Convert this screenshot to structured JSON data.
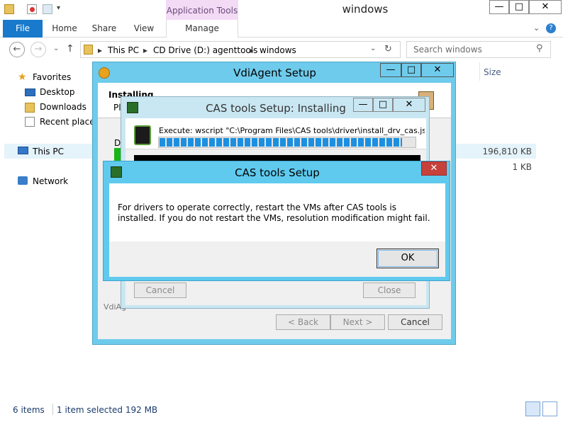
{
  "explorer": {
    "title": "windows",
    "context_tab": "Application Tools",
    "ribbon_tabs": [
      "File",
      "Home",
      "Share",
      "View",
      "Manage"
    ],
    "breadcrumb": [
      "This PC",
      "CD Drive (D:) agenttools",
      "windows"
    ],
    "search_placeholder": "Search windows",
    "nav": {
      "favorites": "Favorites",
      "desktop": "Desktop",
      "downloads": "Downloads",
      "recent": "Recent places",
      "thispc": "This PC",
      "network": "Network"
    },
    "column_size": "Size",
    "sizes": [
      "196,810 KB",
      "1 KB"
    ],
    "status_items": "6 items",
    "status_selected": "1 item selected  192 MB",
    "window_buttons": [
      "—",
      "□",
      "✕"
    ]
  },
  "vdi_dialog": {
    "title": "VdiAgent Setup",
    "header_title": "Installing",
    "header_sub": "Pl",
    "left_letter": "D",
    "footer_brand": "VdiAg",
    "back_label": "< Back",
    "next_label": "Next >",
    "cancel_label": "Cancel",
    "window_buttons": [
      "—",
      "□",
      "✕"
    ]
  },
  "cas_install_dialog": {
    "title": "CAS tools Setup: Installing",
    "execute_text": "Execute: wscript \"C:\\Program Files\\CAS tools\\driver\\install_drv_cas.js\"",
    "progress": 0.95,
    "cancel_label": "Cancel",
    "close_label": "Close",
    "window_buttons": [
      "—",
      "□",
      "✕"
    ]
  },
  "message_box": {
    "title": "CAS tools Setup",
    "text": "For drivers to operate correctly, restart the VMs after CAS tools is installed. If you do not restart the VMs, resolution modification might fail.",
    "ok_label": "OK",
    "close_glyph": "✕"
  },
  "colors": {
    "accent_blue": "#1979ca",
    "dialog_frame": "#6fcbeb",
    "close_red": "#c7413b",
    "progress_blue": "#1c8fe0"
  }
}
